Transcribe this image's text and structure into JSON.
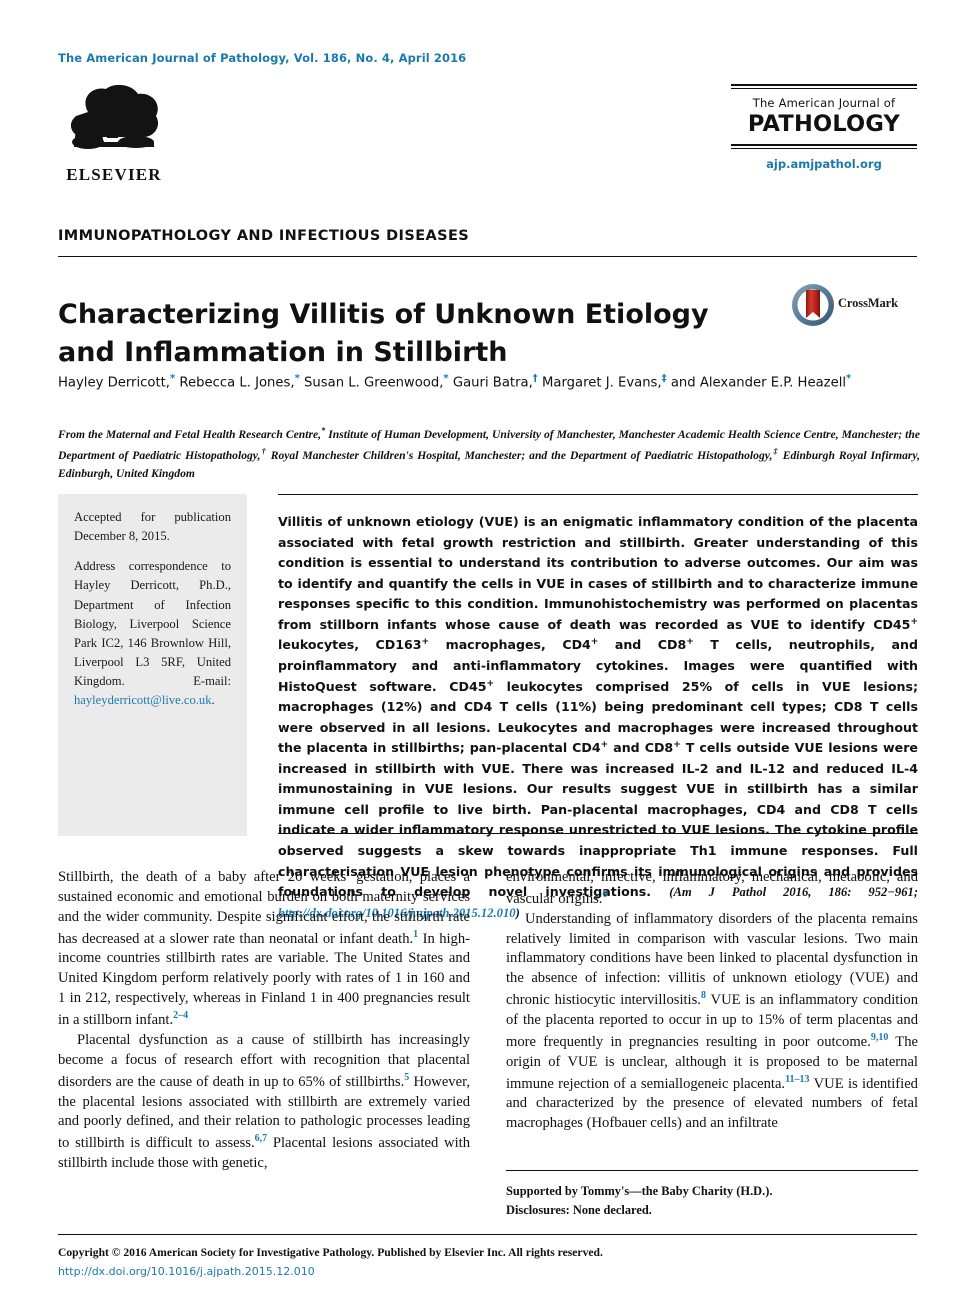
{
  "header": {
    "journal_line": "The American Journal of Pathology, Vol. 186, No. 4, April 2016",
    "publisher_name": "ELSEVIER",
    "masthead_sub": "The American Journal of",
    "masthead_main": "PATHOLOGY",
    "masthead_url": "ajp.amjpathol.org"
  },
  "article": {
    "section": "IMMUNOPATHOLOGY AND INFECTIOUS DISEASES",
    "title": "Characterizing Villitis of Unknown Etiology and Inflammation in Stillbirth",
    "crossmark_label": "CrossMark",
    "affiliations": "From the Maternal and Fetal Health Research Centre,* Institute of Human Development, University of Manchester, Manchester Academic Health Science Centre, Manchester; the Department of Paediatric Histopathology,† Royal Manchester Children's Hospital, Manchester; and the Department of Paediatric Histopathology,‡ Edinburgh Royal Infirmary, Edinburgh, United Kingdom",
    "authors": [
      {
        "name": "Hayley Derricott,",
        "mark": "*"
      },
      {
        "name": "Rebecca L. Jones,",
        "mark": "*"
      },
      {
        "name": "Susan L. Greenwood,",
        "mark": "*"
      },
      {
        "name": "Gauri Batra,",
        "mark": "†"
      },
      {
        "name": "Margaret J. Evans,",
        "mark": "‡"
      },
      {
        "name": "and Alexander E.P. Heazell",
        "mark": "*"
      }
    ]
  },
  "sidebar": {
    "accepted": "Accepted for publication December 8, 2015.",
    "correspondence": "Address correspondence to Hayley Derricott, Ph.D., Department of Infection Biology, Liverpool Science Park IC2, 146 Brownlow Hill, Liverpool L3 5RF, United Kingdom. E-mail:",
    "email": "hayleyderricott@live.co.uk"
  },
  "abstract": {
    "text": "Villitis of unknown etiology (VUE) is an enigmatic inflammatory condition of the placenta associated with fetal growth restriction and stillbirth. Greater understanding of this condition is essential to understand its contribution to adverse outcomes. Our aim was to identify and quantify the cells in VUE in cases of stillbirth and to characterize immune responses specific to this condition. Immunohistochemistry was performed on placentas from stillborn infants whose cause of death was recorded as VUE to identify CD45+ leukocytes, CD163+ macrophages, CD4+ and CD8+ T cells, neutrophils, and proinflammatory and anti-inflammatory cytokines. Images were quantified with HistoQuest software. CD45+ leukocytes comprised 25% of cells in VUE lesions; macrophages (12%) and CD4 T cells (11%) being predominant cell types; CD8 T cells were observed in all lesions. Leukocytes and macrophages were increased throughout the placenta in stillbirths; pan-placental CD4+ and CD8+ T cells outside VUE lesions were increased in stillbirth with VUE. There was increased IL-2 and IL-12 and reduced IL-4 immunostaining in VUE lesions. Our results suggest VUE in stillbirth has a similar immune cell profile to live birth. Pan-placental macrophages, CD4 and CD8 T cells indicate a wider inflammatory response unrestricted to VUE lesions. The cytokine profile observed suggests a skew towards inappropriate Th1 immune responses. Full characterisation VUE lesion phenotype confirms its immunological origins and provides foundations to develop novel investigations.",
    "citation": "(Am J Pathol 2016, 186: 952−961; ",
    "citation_doi": "http://dx.doi.org/10.1016/j.ajpath.2015.12.010",
    "citation_close": ")"
  },
  "body": {
    "left_paragraphs": [
      "Stillbirth, the death of a baby after 20 weeks' gestation, places a sustained economic and emotional burden on both maternity services and the wider community. Despite significant effort, the stillbirth rate has decreased at a slower rate than neonatal or infant death.|1| In high-income countries stillbirth rates are variable. The United States and United Kingdom perform relatively poorly with rates of 1 in 160 and 1 in 212, respectively, whereas in Finland 1 in 400 pregnancies result in a stillborn infant.|2‒4|",
      "Placental dysfunction as a cause of stillbirth has increasingly become a focus of research effort with recognition that placental disorders are the cause of death in up to 65% of stillbirths.|5| However, the placental lesions associated with stillbirth are extremely varied and poorly defined, and their relation to pathologic processes leading to stillbirth is difficult to assess.|6,7| Placental lesions associated with stillbirth include those with genetic,"
    ],
    "right_paragraphs": [
      "environmental, infective, inflammatory, mechanical, metabolic, and vascular origins.|6|",
      "Understanding of inflammatory disorders of the placenta remains relatively limited in comparison with vascular lesions. Two main inflammatory conditions have been linked to placental dysfunction in the absence of infection: villitis of unknown etiology (VUE) and chronic histiocytic intervillositis.|8| VUE is an inflammatory condition of the placenta reported to occur in up to 15% of term placentas and more frequently in pregnancies resulting in poor outcome.|9,10| The origin of VUE is unclear, although it is proposed to be maternal immune rejection of a semiallogeneic placenta.|11‒13| VUE is identified and characterized by the presence of elevated numbers of fetal macrophages (Hofbauer cells) and an infiltrate"
    ]
  },
  "footnote": {
    "line1": "Supported by Tommy's—the Baby Charity (H.D.).",
    "line2": "Disclosures: None declared."
  },
  "footer": {
    "copyright": "Copyright © 2016 American Society for Investigative Pathology. Published by Elsevier Inc. All rights reserved.",
    "doi": "http://dx.doi.org/10.1016/j.ajpath.2015.12.010"
  },
  "colors": {
    "link_blue": "#1a7aad",
    "sidebar_gray": "#ebebeb",
    "crossmark_red": "#c0251c"
  }
}
